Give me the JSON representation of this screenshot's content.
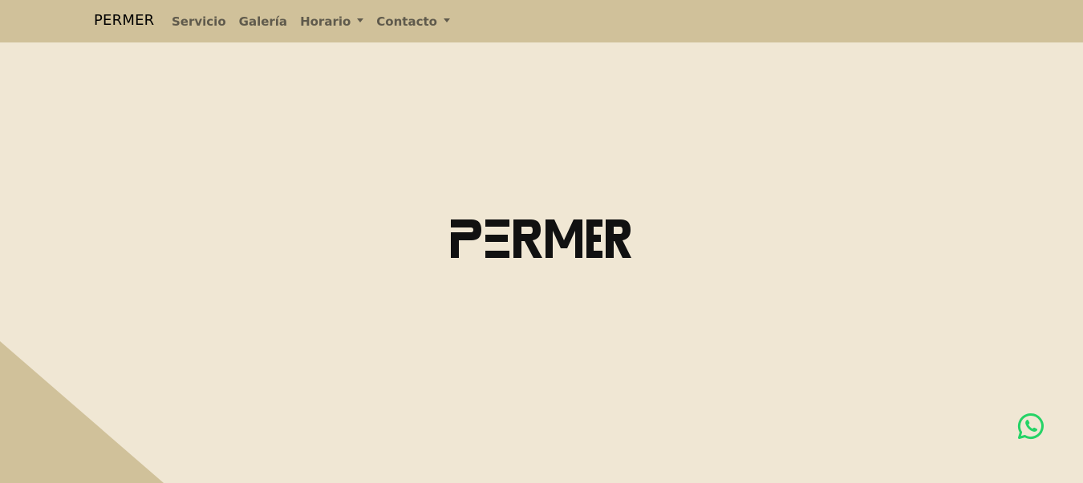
{
  "navbar": {
    "brand": "PERMER",
    "items": [
      {
        "label": "Servicio",
        "dropdown": false
      },
      {
        "label": "Galería",
        "dropdown": false
      },
      {
        "label": "Horario",
        "dropdown": true
      },
      {
        "label": "Contacto",
        "dropdown": true
      }
    ]
  },
  "hero": {
    "logo_text": "PERMER"
  },
  "floating": {
    "icon": "whatsapp-icon",
    "color": "#25d366"
  },
  "colors": {
    "navbar_bg": "#d0c19a",
    "page_bg": "#f0e7d4",
    "accent_triangle": "#d0c19a",
    "nav_text": "#5f5a4c"
  }
}
